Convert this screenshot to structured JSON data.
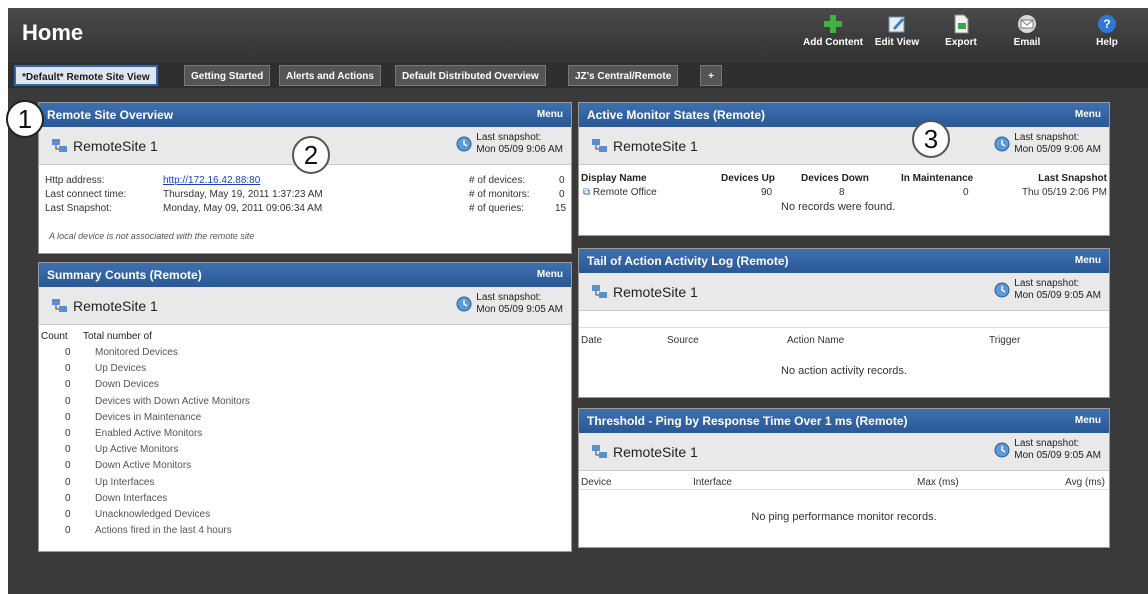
{
  "header": {
    "title": "Home"
  },
  "toolbar": [
    {
      "label": "Add Content",
      "icon": "plus-icon"
    },
    {
      "label": "Edit View",
      "icon": "edit-icon"
    },
    {
      "label": "Export",
      "icon": "export-icon"
    },
    {
      "label": "Email",
      "icon": "email-icon"
    },
    {
      "label": "Help",
      "icon": "help-icon"
    }
  ],
  "tabs": [
    {
      "label": "*Default* Remote Site View"
    },
    {
      "label": "Getting Started"
    },
    {
      "label": "Alerts and Actions"
    },
    {
      "label": "Default Distributed Overview"
    },
    {
      "label": "JZ's Central/Remote"
    },
    {
      "label": "+"
    }
  ],
  "callouts": [
    "1",
    "2",
    "3"
  ],
  "common": {
    "menu": "Menu",
    "site": "RemoteSite 1",
    "last_snapshot_label": "Last snapshot:"
  },
  "remote_site_overview": {
    "title": "Remote Site Overview",
    "snapshot_time": "Mon 05/09 9:06 AM",
    "http_label": "Http address:",
    "http_value": "http://172.16.42.88:80",
    "last_connect_label": "Last connect time:",
    "last_connect_value": "Thursday, May 19, 2011 1:37:23 AM",
    "last_snapshot_label": "Last Snapshot:",
    "last_snapshot_value": "Monday, May 09, 2011 09:06:34 AM",
    "devices_label": "# of devices:",
    "devices_value": "0",
    "monitors_label": "# of monitors:",
    "monitors_value": "0",
    "queries_label": "# of queries:",
    "queries_value": "15",
    "note": "A local device is not associated with the remote site"
  },
  "summary_counts": {
    "title": "Summary Counts (Remote)",
    "snapshot_time": "Mon 05/09 9:05 AM",
    "col_count": "Count",
    "col_total": "Total number of",
    "rows": [
      {
        "count": "0",
        "label": "Monitored Devices"
      },
      {
        "count": "0",
        "label": "Up Devices"
      },
      {
        "count": "0",
        "label": "Down Devices"
      },
      {
        "count": "0",
        "label": "Devices with Down Active Monitors"
      },
      {
        "count": "0",
        "label": "Devices in Maintenance"
      },
      {
        "count": "0",
        "label": "Enabled Active Monitors"
      },
      {
        "count": "0",
        "label": "Up Active Monitors"
      },
      {
        "count": "0",
        "label": "Down Active Monitors"
      },
      {
        "count": "0",
        "label": "Up Interfaces"
      },
      {
        "count": "0",
        "label": "Down Interfaces"
      },
      {
        "count": "0",
        "label": "Unacknowledged Devices"
      },
      {
        "count": "0",
        "label": "Actions fired in the last 4 hours"
      }
    ]
  },
  "active_monitor_states": {
    "title": "Active Monitor States (Remote)",
    "snapshot_time": "Mon 05/09 9:06 AM",
    "cols": [
      "Display Name",
      "Devices Up",
      "Devices Down",
      "In Maintenance",
      "Last Snapshot"
    ],
    "row": {
      "name": "Remote Office",
      "up": "90",
      "down": "8",
      "maint": "0",
      "snapshot": "Thu 05/19 2:06 PM"
    },
    "empty": "No records were found."
  },
  "action_log": {
    "title": "Tail of Action Activity Log (Remote)",
    "snapshot_time": "Mon 05/09 9:05 AM",
    "cols": [
      "Date",
      "Source",
      "Action Name",
      "Trigger"
    ],
    "empty": "No action activity records."
  },
  "threshold_ping": {
    "title": "Threshold - Ping by Response Time Over 1 ms (Remote)",
    "snapshot_time": "Mon 05/09 9:05 AM",
    "cols": [
      "Device",
      "Interface",
      "Max (ms)",
      "Avg (ms)"
    ],
    "empty": "No ping performance monitor records."
  }
}
